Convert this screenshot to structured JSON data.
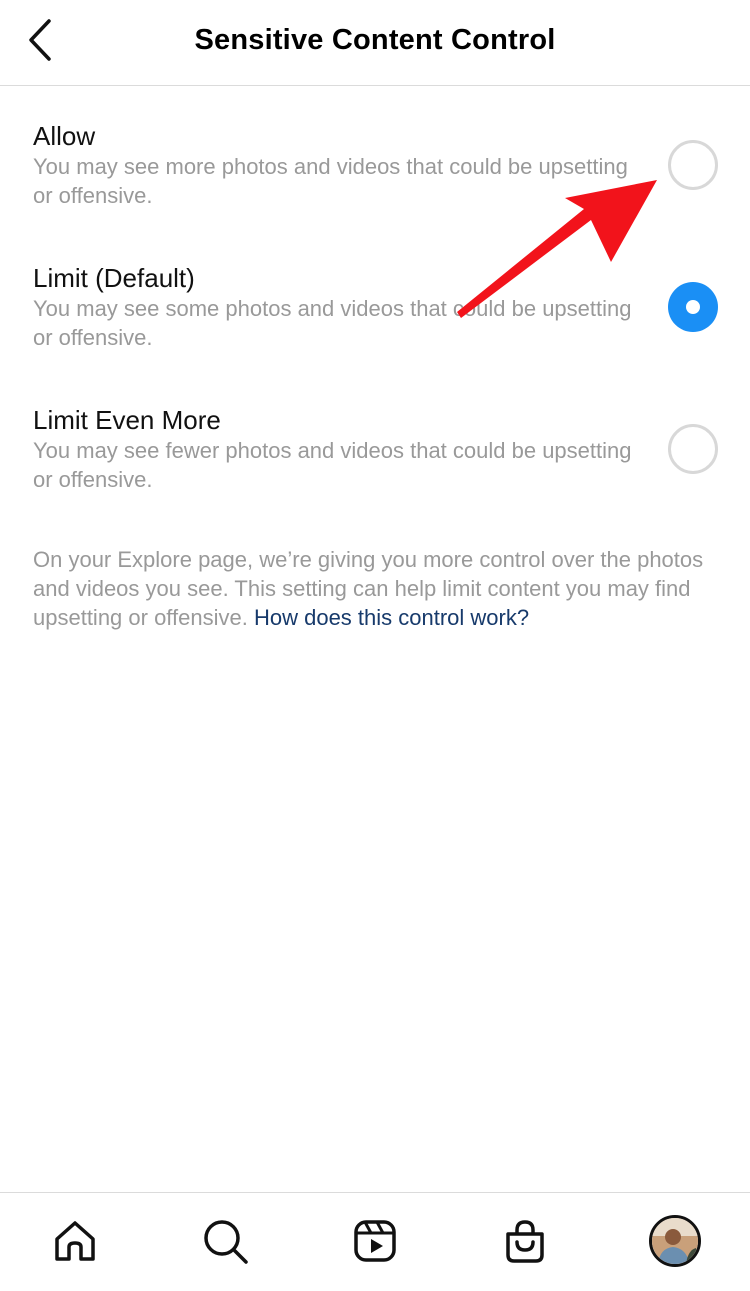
{
  "header": {
    "title": "Sensitive Content Control",
    "back_icon": "chevron-left-icon"
  },
  "options": [
    {
      "label": "Allow",
      "description": "You may see more photos and videos that could be upsetting or offensive.",
      "selected": false
    },
    {
      "label": "Limit (Default)",
      "description": "You may see some photos and videos that could be upsetting or offensive.",
      "selected": true
    },
    {
      "label": "Limit Even More",
      "description": "You may see fewer photos and videos that could be upsetting or offensive.",
      "selected": false
    }
  ],
  "info": {
    "text": "On your Explore page, we’re giving you more control over the photos and videos you see. This setting can help limit content you may find upsetting or offensive. ",
    "link": "How does this control work?"
  },
  "tabbar": {
    "items": [
      "home-icon",
      "search-icon",
      "reels-icon",
      "shop-icon",
      "profile-avatar"
    ]
  },
  "colors": {
    "accent": "#1a8ff5",
    "link": "#173a6b",
    "annotation_arrow": "#f2131b"
  }
}
